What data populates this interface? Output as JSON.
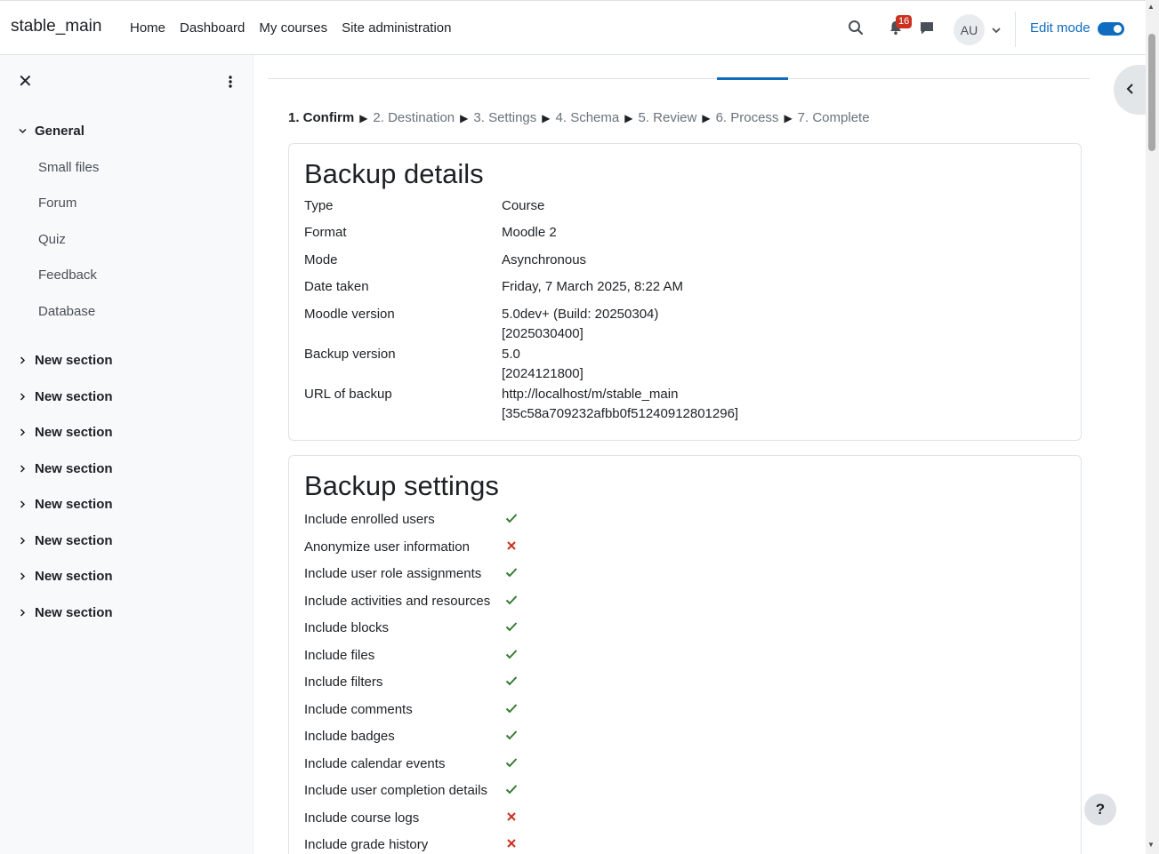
{
  "navbar": {
    "brand": "stable_main",
    "links": [
      "Home",
      "Dashboard",
      "My courses",
      "Site administration"
    ],
    "notification_count": "16",
    "avatar_initials": "AU",
    "edit_mode_label": "Edit mode",
    "edit_mode_on": true
  },
  "sidebar": {
    "sections": [
      {
        "label": "General",
        "expanded": true,
        "items": [
          "Small files",
          "Forum",
          "Quiz",
          "Feedback",
          "Database"
        ]
      },
      {
        "label": "New section",
        "expanded": false
      },
      {
        "label": "New section",
        "expanded": false
      },
      {
        "label": "New section",
        "expanded": false
      },
      {
        "label": "New section",
        "expanded": false
      },
      {
        "label": "New section",
        "expanded": false
      },
      {
        "label": "New section",
        "expanded": false
      },
      {
        "label": "New section",
        "expanded": false
      },
      {
        "label": "New section",
        "expanded": false
      }
    ]
  },
  "steps": [
    "1. Confirm",
    "2. Destination",
    "3. Settings",
    "4. Schema",
    "5. Review",
    "6. Process",
    "7. Complete"
  ],
  "backup_details": {
    "title": "Backup details",
    "rows": [
      {
        "label": "Type",
        "value": "Course"
      },
      {
        "label": "Format",
        "value": "Moodle 2"
      },
      {
        "label": "Mode",
        "value": "Asynchronous"
      },
      {
        "label": "Date taken",
        "value": "Friday, 7 March 2025, 8:22 AM"
      },
      {
        "label": "Moodle version",
        "value": "5.0dev+ (Build: 20250304)",
        "value2": "[2025030400]"
      },
      {
        "label": "Backup version",
        "value": "5.0",
        "value2": "[2024121800]"
      },
      {
        "label": "URL of backup",
        "value": "http://localhost/m/stable_main",
        "value2": "[35c58a709232afbb0f51240912801296]"
      }
    ]
  },
  "backup_settings": {
    "title": "Backup settings",
    "rows": [
      {
        "label": "Include enrolled users",
        "enabled": true
      },
      {
        "label": "Anonymize user information",
        "enabled": false
      },
      {
        "label": "Include user role assignments",
        "enabled": true
      },
      {
        "label": "Include activities and resources",
        "enabled": true
      },
      {
        "label": "Include blocks",
        "enabled": true
      },
      {
        "label": "Include files",
        "enabled": true
      },
      {
        "label": "Include filters",
        "enabled": true
      },
      {
        "label": "Include comments",
        "enabled": true
      },
      {
        "label": "Include badges",
        "enabled": true
      },
      {
        "label": "Include calendar events",
        "enabled": true
      },
      {
        "label": "Include user completion details",
        "enabled": true
      },
      {
        "label": "Include course logs",
        "enabled": false
      },
      {
        "label": "Include grade history",
        "enabled": false
      }
    ]
  },
  "colors": {
    "accent": "#0f6cbf",
    "check": "#357a32",
    "cross": "#ca3120"
  },
  "help_label": "?"
}
